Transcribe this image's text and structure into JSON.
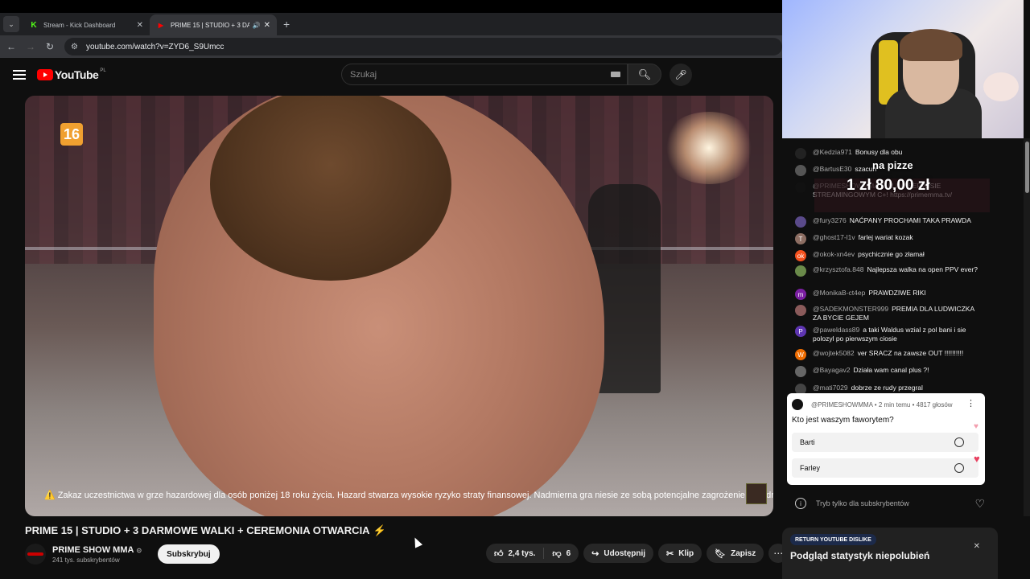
{
  "browser": {
    "tabs": [
      {
        "title": "Stream - Kick Dashboard",
        "favicon": "K",
        "favicon_color": "#53fc18"
      },
      {
        "title": "PRIME 15 | STUDIO + 3 DA",
        "favicon": "▶",
        "favicon_color": "#ff0000"
      }
    ],
    "url": "youtube.com/watch?v=ZYD6_S9Umcc"
  },
  "youtube": {
    "logo": "YouTube",
    "region": "PL",
    "search_placeholder": "Szukaj"
  },
  "video": {
    "age_rating": "16",
    "warning": "⚠️ Zakaz uczestnictwa w grze hazardowej dla osób poniżej 18 roku życia. Hazard stwarza wysokie ryzyko straty finansowej. Nadmierna gra niesie ze sobą potencjalne zagrożenie dla zdrowia",
    "title": "PRIME 15 | STUDIO + 3 DARMOWE WALKI + CEREMONIA OTWARCIA",
    "title_emoji": "⚡"
  },
  "channel": {
    "name": "PRIME SHOW MMA",
    "subscribers": "241 tys. subskrybentów",
    "subscribe_label": "Subskrybuj"
  },
  "actions": {
    "likes": "2,4 tys.",
    "dislikes": "6",
    "share": "Udostępnij",
    "clip": "Klip",
    "save": "Zapisz"
  },
  "overlay": {
    "donation_text": "na pizze",
    "donation_amount": "1 zł  80,00 zł"
  },
  "chat": {
    "messages": [
      {
        "user": "@Kedzia971",
        "text": "Bonusy dla obu",
        "avatar": "",
        "color": "#222"
      },
      {
        "user": "@BartusE30",
        "text": "szacun",
        "avatar": "",
        "color": "#555"
      },
      {
        "user": "@PRIMESHOWMMA",
        "text": "GALI W SERWISIE STREAMINGOWYM C+! https://primemma.tv/",
        "avatar": "",
        "color": "#111"
      },
      {
        "user": "@fury3276",
        "text": "NAĆPANY PROCHAMI TAKA PRAWDA",
        "avatar": "",
        "color": "#5a4a8a"
      },
      {
        "user": "@ghost17-l1v",
        "text": "farlej wariat kozak",
        "avatar": "T",
        "color": "#8d6e63"
      },
      {
        "user": "@okok-xn4ev",
        "text": "psychicznie go złamał",
        "avatar": "ok",
        "color": "#f4511e"
      },
      {
        "user": "@krzysztofa.848",
        "text": "Najlepsza walka na open PPV ever?",
        "avatar": "",
        "color": "#6a8a4a"
      },
      {
        "user": "@MonikaB-ct4ep",
        "text": "PRAWDZIWE RIKI",
        "avatar": "m",
        "color": "#7b1fa2"
      },
      {
        "user": "@SADEKMONSTER999",
        "text": "PREMIA DLA LUDWICZKA ZA BYCIE GEJEM",
        "avatar": "",
        "color": "#8a5a5a"
      },
      {
        "user": "@paweldass89",
        "text": "a taki Waldus wzial z pol bani i sie polozyl po pierwszym ciosie",
        "avatar": "P",
        "color": "#5e35b1"
      },
      {
        "user": "@wojtek5082",
        "text": "ver SRACZ na zawsze OUT !!!!!!!!!!",
        "avatar": "W",
        "color": "#ef6c00"
      },
      {
        "user": "@Bayagav2",
        "text": "Działa wam canal plus ?!",
        "avatar": "",
        "color": "#666"
      },
      {
        "user": "@mati7029",
        "text": "dobrze ze rudy przegral",
        "avatar": "",
        "color": "#444"
      }
    ]
  },
  "poll": {
    "meta": "@PRIMESHOWMMA • 2 min temu • 4817 głosów",
    "question": "Kto jest waszym faworytem?",
    "options": [
      "Barti",
      "Farley"
    ]
  },
  "sub_only": "Tryb tylko dla subskrybentów",
  "ryd": {
    "badge": "RETURN YOUTUBE DISLIKE",
    "title": "Podgląd statystyk niepolubień"
  }
}
